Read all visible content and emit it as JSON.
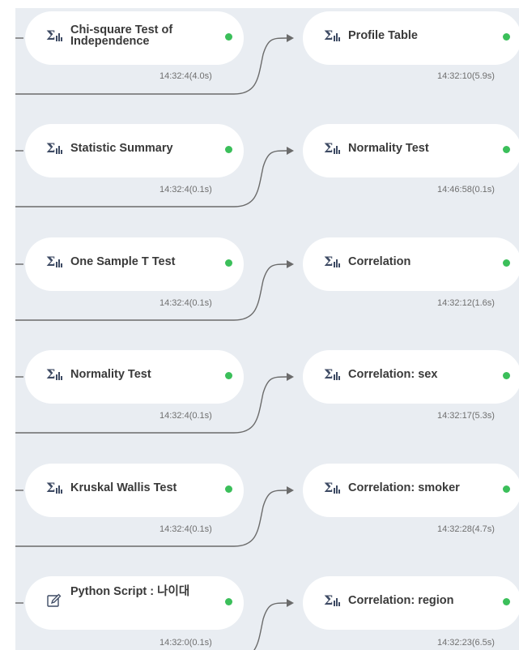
{
  "left_nodes": [
    {
      "label": "Chi-square Test of Independence",
      "time": "14:32:4(4.0s)",
      "icon": "statistics-icon"
    },
    {
      "label": "Statistic Summary",
      "time": "14:32:4(0.1s)",
      "icon": "statistics-icon"
    },
    {
      "label": "One Sample T Test",
      "time": "14:32:4(0.1s)",
      "icon": "statistics-icon"
    },
    {
      "label": "Normality Test",
      "time": "14:32:4(0.1s)",
      "icon": "statistics-icon"
    },
    {
      "label": "Kruskal Wallis Test",
      "time": "14:32:4(0.1s)",
      "icon": "statistics-icon"
    },
    {
      "label": "Python Script : 나이대",
      "time": "14:32:0(0.1s)",
      "icon": "python-script-edit-icon"
    }
  ],
  "right_nodes": [
    {
      "label": "Profile Table",
      "time": "14:32:10(5.9s)",
      "icon": "statistics-icon"
    },
    {
      "label": "Normality Test",
      "time": "14:46:58(0.1s)",
      "icon": "statistics-icon"
    },
    {
      "label": "Correlation",
      "time": "14:32:12(1.6s)",
      "icon": "statistics-icon"
    },
    {
      "label": "Correlation: sex",
      "time": "14:32:17(5.3s)",
      "icon": "statistics-icon"
    },
    {
      "label": "Correlation: smoker",
      "time": "14:32:28(4.7s)",
      "icon": "statistics-icon"
    },
    {
      "label": "Correlation: region",
      "time": "14:32:23(6.5s)",
      "icon": "statistics-icon"
    }
  ],
  "colors": {
    "canvas_bg": "#e9edf2",
    "node_bg": "#ffffff",
    "port": "#3bbf5a",
    "edge": "#6b6b6b",
    "icon": "#3d4a63"
  }
}
